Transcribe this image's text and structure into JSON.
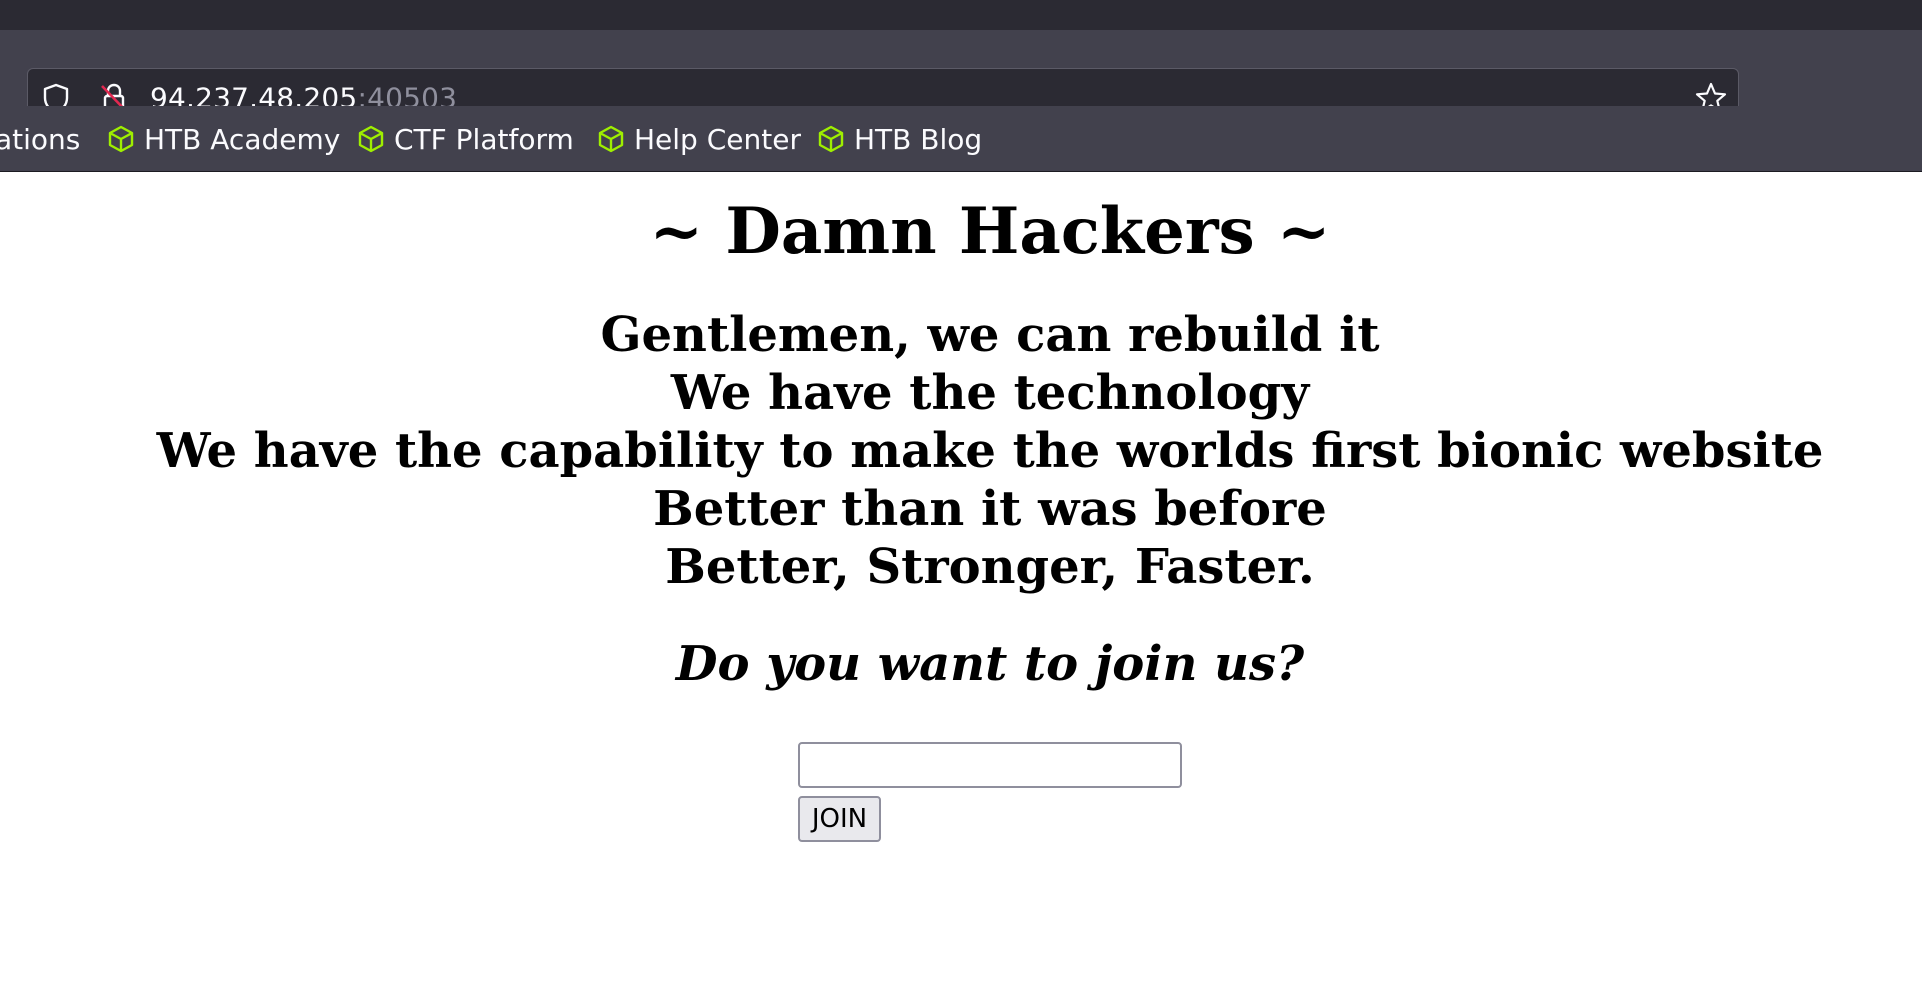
{
  "browser": {
    "url_host": "94.237.48.205",
    "url_port": ":40503",
    "bookmarks": [
      {
        "label": "ations",
        "truncated": true
      },
      {
        "label": "HTB Academy",
        "icon": "htb-cube-icon"
      },
      {
        "label": "CTF Platform",
        "icon": "htb-cube-icon"
      },
      {
        "label": "Help Center",
        "icon": "htb-cube-icon"
      },
      {
        "label": "HTB Blog",
        "icon": "htb-cube-icon"
      }
    ],
    "colors": {
      "chrome_dark": "#2b2a33",
      "toolbar": "#42414d",
      "bookmark_icon_green": "#9fef00"
    }
  },
  "page": {
    "title": "~ Damn Hackers ~",
    "lines": [
      "Gentlemen, we can rebuild it",
      "We have the technology",
      "We have the capability to make the worlds first bionic website",
      "Better than it was before",
      "Better, Stronger, Faster."
    ],
    "question": "Do you want to join us?",
    "input_value": "",
    "join_label": "JOIN"
  }
}
